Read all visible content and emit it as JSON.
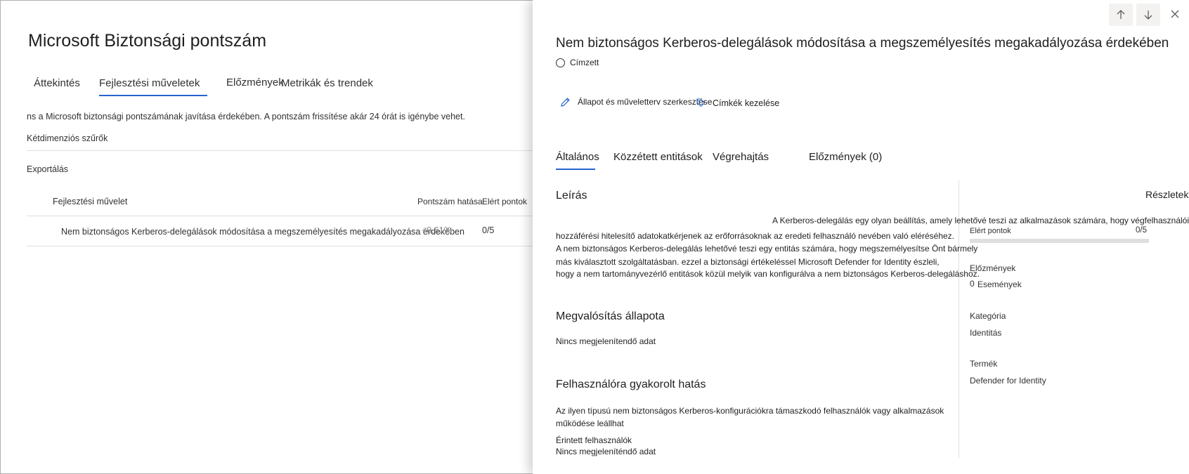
{
  "background_page": {
    "title": "Microsoft Biztonsági pontszám",
    "tabs": [
      {
        "label": "Áttekintés"
      },
      {
        "label": "Fejlesztési műveletek"
      },
      {
        "label": "Előzmények"
      },
      {
        "label": "Metrikák és trendek"
      }
    ],
    "info_text": "ns a Microsoft biztonsági pontszámának javítása érdekében. A pontszám frissítése akár 24 órát is igénybe vehet.",
    "filter_label": "Kétdimenziós szűrők",
    "export_label": "Exportálás",
    "table": {
      "headers": [
        "Fejlesztési művelet",
        "Pontszám hatása",
        "Elért pontok"
      ],
      "rows": [
        {
          "action": "Nem biztonságos Kerberos-delegálások módosítása a megszemélyesítés megakadályozása érdekében",
          "impact": "+0,61%",
          "points": "0/5"
        }
      ]
    }
  },
  "panel": {
    "title": "Nem biztonságos Kerberos-delegálások módosítása a megszemélyesítés megakadályozása érdekében",
    "assignee_label": "Címzett",
    "commands": {
      "edit_label": "Állapot és műveletterv szerkesztése",
      "tags_label": "Címkék kezelése"
    },
    "tabs": [
      {
        "label": "Általános"
      },
      {
        "label": "Közzétett entitások"
      },
      {
        "label": "Végrehajtás"
      },
      {
        "label": "Előzmények (0)"
      }
    ],
    "description": {
      "heading": "Leírás",
      "line1": "A Kerberos-delegálás egy olyan beállítás, amely lehetővé teszi az alkalmazások számára, hogy végfelhasználói",
      "line2": "hozzáférési hitelesítő adatokatkérjenek az erőforrásoknak az eredeti felhasználó nevében való eléréséhez.",
      "line3": "A nem biztonságos Kerberos-delegálás lehetővé teszi egy entitás számára, hogy megszemélyesítse Önt bármely",
      "line4": "más kiválasztott szolgáltatásban. ezzel a biztonsági értékeléssel Microsoft Defender for Identity észleli,",
      "line5": "hogy a nem tartományvezérlő entitások közül melyik van konfigurálva a nem biztonságos Kerberos-delegáláshoz."
    },
    "implementation": {
      "heading": "Megvalósítás állapota",
      "value": "Nincs megjelenítendő adat"
    },
    "user_impact": {
      "heading": "Felhasználóra gyakorolt hatás",
      "line1": "Az ilyen típusú nem biztonságos Kerberos-konfigurációkra támaszkodó felhasználók vagy alkalmazások",
      "line2": "működése leállhat",
      "affected_label": "Érintett felhasználók",
      "affected_value": "Nincs megjeleníténdő adat"
    },
    "details": {
      "heading": "Részletek",
      "points_label": "Elért pontok",
      "points_value": "0/5",
      "points_fraction": 0,
      "history_label": "Előzmények",
      "history_count": "0",
      "history_events": "Események",
      "category_label": "Kategória",
      "category_value": "Identitás",
      "product_label": "Termék",
      "product_value": "Defender for Identity"
    }
  },
  "colors": {
    "accent": "#2564cf",
    "text": "#201f1e",
    "divider": "#e1dfdd"
  },
  "icons": [
    "arrow-up-icon",
    "arrow-down-icon",
    "close-icon",
    "pencil-icon",
    "tag-icon",
    "radio-icon"
  ]
}
